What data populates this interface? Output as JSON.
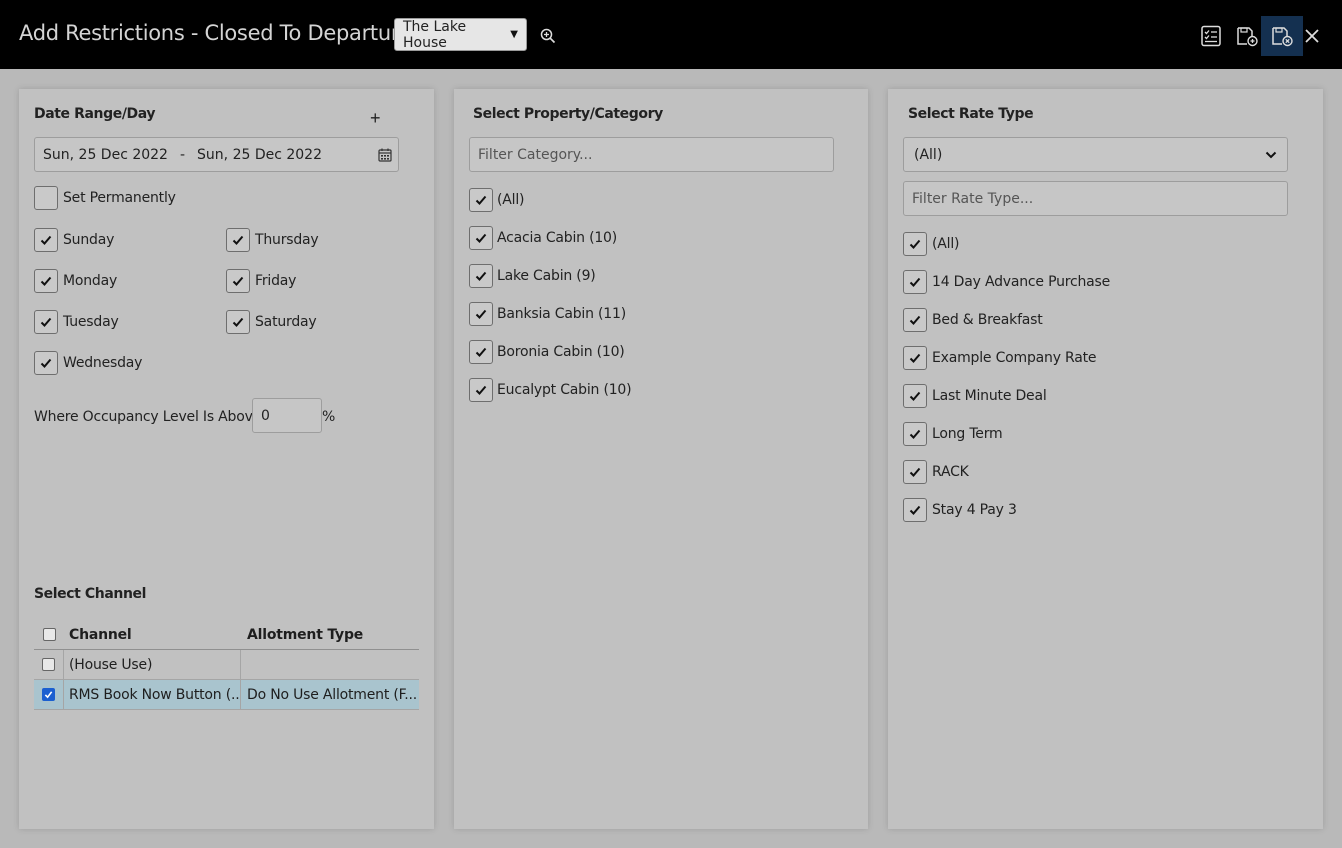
{
  "header": {
    "title": "Add Restrictions - Closed To Departure",
    "property": "The Lake House"
  },
  "date_panel": {
    "heading": "Date Range/Day",
    "date_range": {
      "from": "Sun, 25 Dec 2022",
      "sep": "-",
      "to": "Sun, 25 Dec 2022"
    },
    "set_permanently": "Set Permanently",
    "days": {
      "sunday": "Sunday",
      "monday": "Monday",
      "tuesday": "Tuesday",
      "wednesday": "Wednesday",
      "thursday": "Thursday",
      "friday": "Friday",
      "saturday": "Saturday"
    },
    "occupancy_label": "Where Occupancy Level Is Above",
    "occupancy_value": "0",
    "occupancy_unit": "%"
  },
  "channel": {
    "heading": "Select Channel",
    "columns": {
      "channel": "Channel",
      "allotment": "Allotment Type"
    },
    "rows": [
      {
        "channel": "(House Use)",
        "allotment": "",
        "checked": false
      },
      {
        "channel": "RMS Book Now Button (...",
        "allotment": "Do No Use Allotment (F...",
        "checked": true
      }
    ]
  },
  "category_panel": {
    "heading": "Select Property/Category",
    "filter_placeholder": "Filter Category...",
    "items": [
      "(All)",
      "Acacia Cabin (10)",
      "Lake Cabin (9)",
      "Banksia Cabin (11)",
      "Boronia Cabin (10)",
      "Eucalypt Cabin (10)"
    ]
  },
  "rate_panel": {
    "heading": "Select Rate Type",
    "selected": "(All)",
    "filter_placeholder": "Filter Rate Type...",
    "items": [
      "(All)",
      "14 Day Advance Purchase",
      "Bed & Breakfast",
      "Example Company Rate",
      "Last Minute Deal",
      "Long Term",
      "RACK",
      "Stay 4 Pay 3"
    ]
  }
}
